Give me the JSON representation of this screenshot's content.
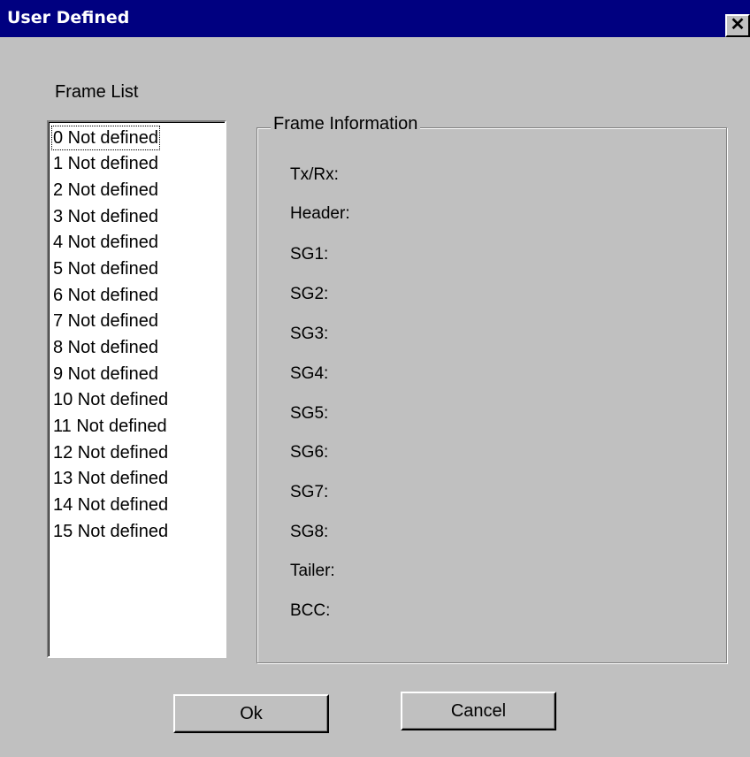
{
  "window": {
    "title": "User Defined",
    "close_glyph": "✕"
  },
  "frame_list": {
    "label": "Frame List",
    "items": [
      "0 Not defined",
      "1 Not defined",
      "2 Not defined",
      "3 Not defined",
      "4 Not defined",
      "5 Not defined",
      "6 Not defined",
      "7 Not defined",
      "8 Not defined",
      "9 Not defined",
      "10 Not defined",
      "11 Not defined",
      "12 Not defined",
      "13 Not defined",
      "14 Not defined",
      "15 Not defined"
    ]
  },
  "frame_info": {
    "title": "Frame Information",
    "fields": [
      "Tx/Rx:",
      "Header:",
      "SG1:",
      "SG2:",
      "SG3:",
      "SG4:",
      "SG5:",
      "SG6:",
      "SG7:",
      "SG8:",
      "Tailer:",
      "BCC:"
    ]
  },
  "buttons": {
    "ok": "Ok",
    "cancel": "Cancel"
  },
  "colors": {
    "titlebar": "#000080",
    "face": "#c0c0c0",
    "list_bg": "#ffffff"
  },
  "icons": {
    "close": "close-icon"
  }
}
